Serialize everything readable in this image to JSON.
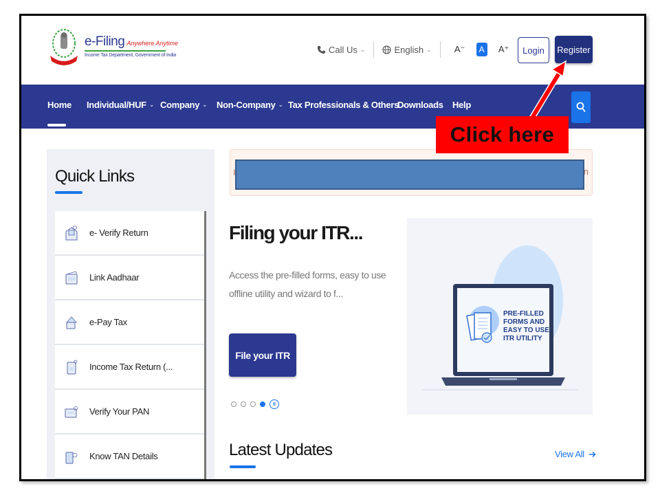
{
  "header": {
    "brand_name": "e-Filing",
    "brand_tagline": "Anywhere Anytime",
    "brand_subtitle": "Income Tax Department, Government of India",
    "call_us": "Call Us",
    "language": "English",
    "font_decrease": "A⁻",
    "font_normal": "A",
    "font_increase": "A⁺",
    "login_label": "Login",
    "register_label": "Register"
  },
  "nav": {
    "items": [
      {
        "label": "Home",
        "has_dropdown": false,
        "active": true
      },
      {
        "label": "Individual/HUF",
        "has_dropdown": true
      },
      {
        "label": "Company",
        "has_dropdown": true
      },
      {
        "label": "Non-Company",
        "has_dropdown": true
      },
      {
        "label": "Tax Professionals & Others",
        "has_dropdown": true
      },
      {
        "label": "Downloads",
        "has_dropdown": false
      },
      {
        "label": "Help",
        "has_dropdown": false
      }
    ],
    "chevron": "⌵"
  },
  "quick_links": {
    "title": "Quick Links",
    "items": [
      {
        "label": "e- Verify Return",
        "icon": "envelope-verify-icon"
      },
      {
        "label": "Link Aadhaar",
        "icon": "aadhaar-card-icon"
      },
      {
        "label": "e-Pay Tax",
        "icon": "wallet-pay-icon"
      },
      {
        "label": "Income Tax Return (...",
        "icon": "document-return-icon"
      },
      {
        "label": "Verify Your PAN",
        "icon": "pan-card-verify-icon"
      },
      {
        "label": "Know TAN Details",
        "icon": "tan-details-icon"
      }
    ]
  },
  "banner": {
    "left_fragment": "I",
    "right_fragment": "n"
  },
  "hero": {
    "title": "Filing your ITR...",
    "description": "Access the pre-filled forms, easy to use offline utility and wizard to f...",
    "button_label": "File your ITR",
    "carousel_total": 4,
    "carousel_active_index": 3,
    "illustration_text": [
      "PRE-FILLED",
      "FORMS AND",
      "EASY TO USE",
      "ITR UTILITY"
    ]
  },
  "latest_updates": {
    "title": "Latest Updates",
    "view_all": "View All"
  },
  "annotation": {
    "callout_text": "Click here",
    "target": "Register"
  },
  "colors": {
    "primary": "#2b3990",
    "accent": "#1a73e8",
    "callout": "#ff0000",
    "redaction": "#4f81bd"
  }
}
